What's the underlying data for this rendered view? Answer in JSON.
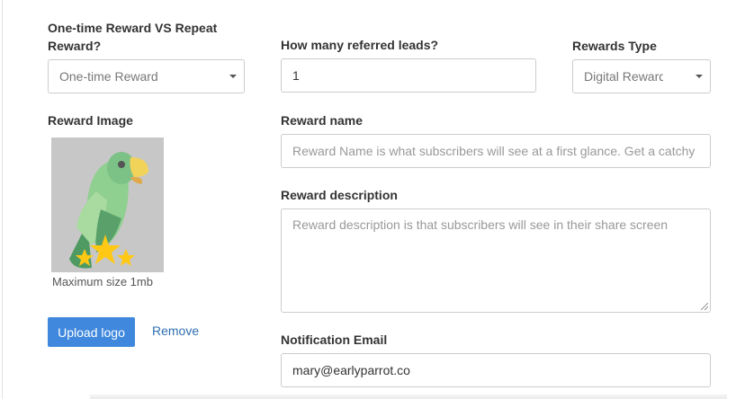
{
  "reward_frequency": {
    "label": "One-time Reward VS Repeat Reward?",
    "value": "One-time Reward"
  },
  "referred_leads": {
    "label": "How many referred leads?",
    "value": "1"
  },
  "rewards_type": {
    "label": "Rewards Type",
    "value": "Digital Reward"
  },
  "reward_image": {
    "label": "Reward Image",
    "caption": "Maximum size 1mb",
    "upload_label": "Upload logo",
    "remove_label": "Remove"
  },
  "reward_name": {
    "label": "Reward name",
    "placeholder": "Reward Name is what subscribers will see at a first glance. Get a catchy"
  },
  "reward_description": {
    "label": "Reward description",
    "placeholder": "Reward description is that subscribers will see in their share screen"
  },
  "notification_email": {
    "label": "Notification Email",
    "value": "mary@earlyparrot.co"
  },
  "colors": {
    "primary_button": "#3f88dd",
    "link": "#2f6fb0",
    "image_background": "#c7c7c7",
    "parrot_green_light": "#8fcf8f",
    "parrot_green_dark": "#5aa06a",
    "beak": "#f2d35a",
    "star": "#ffc815"
  }
}
